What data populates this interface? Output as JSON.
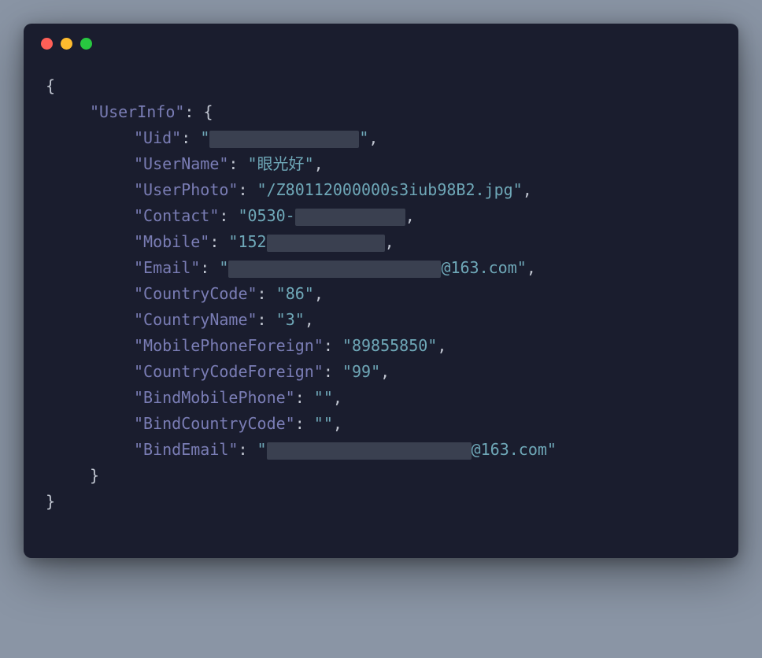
{
  "window": {
    "controls": [
      "close",
      "minimize",
      "zoom"
    ]
  },
  "json_display": {
    "root_key": "UserInfo",
    "entries": [
      {
        "key": "Uid",
        "value_prefix": "",
        "redacted": true,
        "redact_width": 190,
        "value_suffix": ""
      },
      {
        "key": "UserName",
        "value_prefix": "眼光好",
        "redacted": false,
        "value_suffix": ""
      },
      {
        "key": "UserPhoto",
        "value_prefix": "/Z80112000000s3iub98B2.jpg",
        "redacted": false,
        "value_suffix": ""
      },
      {
        "key": "Contact",
        "value_prefix": "0530-",
        "redacted": true,
        "redact_width": 140,
        "value_suffix": "",
        "open_end": true
      },
      {
        "key": "Mobile",
        "value_prefix": "152",
        "redacted": true,
        "redact_width": 150,
        "value_suffix": "",
        "open_end": true
      },
      {
        "key": "Email",
        "value_prefix": "",
        "redacted": true,
        "redact_width": 270,
        "value_suffix": "@163.com"
      },
      {
        "key": "CountryCode",
        "value_prefix": "86",
        "redacted": false,
        "value_suffix": ""
      },
      {
        "key": "CountryName",
        "value_prefix": "3",
        "redacted": false,
        "value_suffix": ""
      },
      {
        "key": "MobilePhoneForeign",
        "value_prefix": "89855850",
        "redacted": false,
        "value_suffix": ""
      },
      {
        "key": "CountryCodeForeign",
        "value_prefix": "99",
        "redacted": false,
        "value_suffix": ""
      },
      {
        "key": "BindMobilePhone",
        "value_prefix": "",
        "redacted": false,
        "value_suffix": ""
      },
      {
        "key": "BindCountryCode",
        "value_prefix": "",
        "redacted": false,
        "value_suffix": ""
      },
      {
        "key": "BindEmail",
        "value_prefix": "",
        "redacted": true,
        "redact_width": 260,
        "value_suffix": "@163.com",
        "last": true
      }
    ]
  }
}
